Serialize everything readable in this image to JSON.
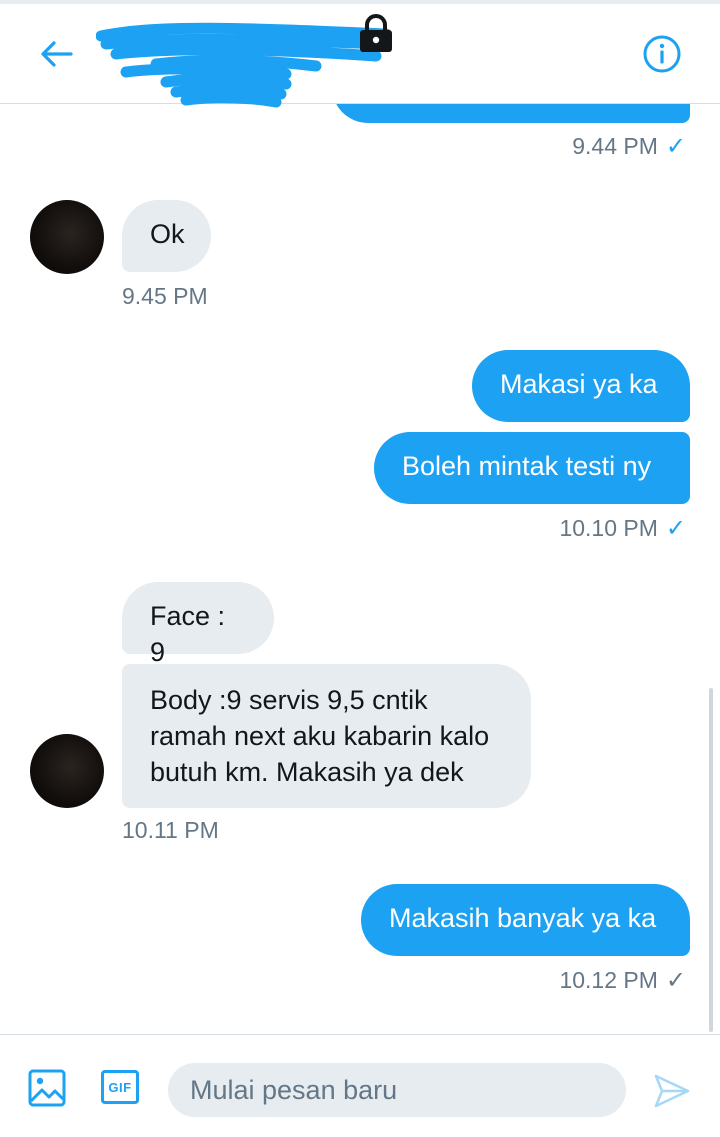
{
  "header": {
    "title": "",
    "back_icon": "arrow-left-icon",
    "info_icon": "info-icon",
    "lock_icon": "lock-icon"
  },
  "messages": [
    {
      "direction": "outgoing",
      "text": "",
      "partial": true
    },
    {
      "direction": "outgoing-timestamp",
      "time": "9.44 PM"
    },
    {
      "direction": "incoming",
      "text": "Ok"
    },
    {
      "direction": "incoming-timestamp",
      "time": "9.45 PM"
    },
    {
      "direction": "outgoing",
      "text": "Makasi ya ka"
    },
    {
      "direction": "outgoing",
      "text": "Boleh mintak testi ny"
    },
    {
      "direction": "outgoing-timestamp",
      "time": "10.10 PM"
    },
    {
      "direction": "incoming",
      "text": "Face : 9"
    },
    {
      "direction": "incoming",
      "lines": [
        "Body :9 servis 9,5 cntik",
        "ramah next aku kabarin kalo",
        "butuh km. Makasih ya dek"
      ]
    },
    {
      "direction": "incoming-timestamp",
      "time": "10.11 PM"
    },
    {
      "direction": "outgoing",
      "text": "Makasih banyak ya ka"
    },
    {
      "direction": "outgoing-timestamp",
      "time": "10.12 PM"
    }
  ],
  "composer": {
    "placeholder": "Mulai pesan baru",
    "gif_label": "GIF",
    "media_icon": "image-icon",
    "send_icon": "send-icon"
  },
  "colors": {
    "accent": "#1da1f2",
    "incoming_bubble": "#e6ecf0",
    "timestamp": "#657786"
  }
}
